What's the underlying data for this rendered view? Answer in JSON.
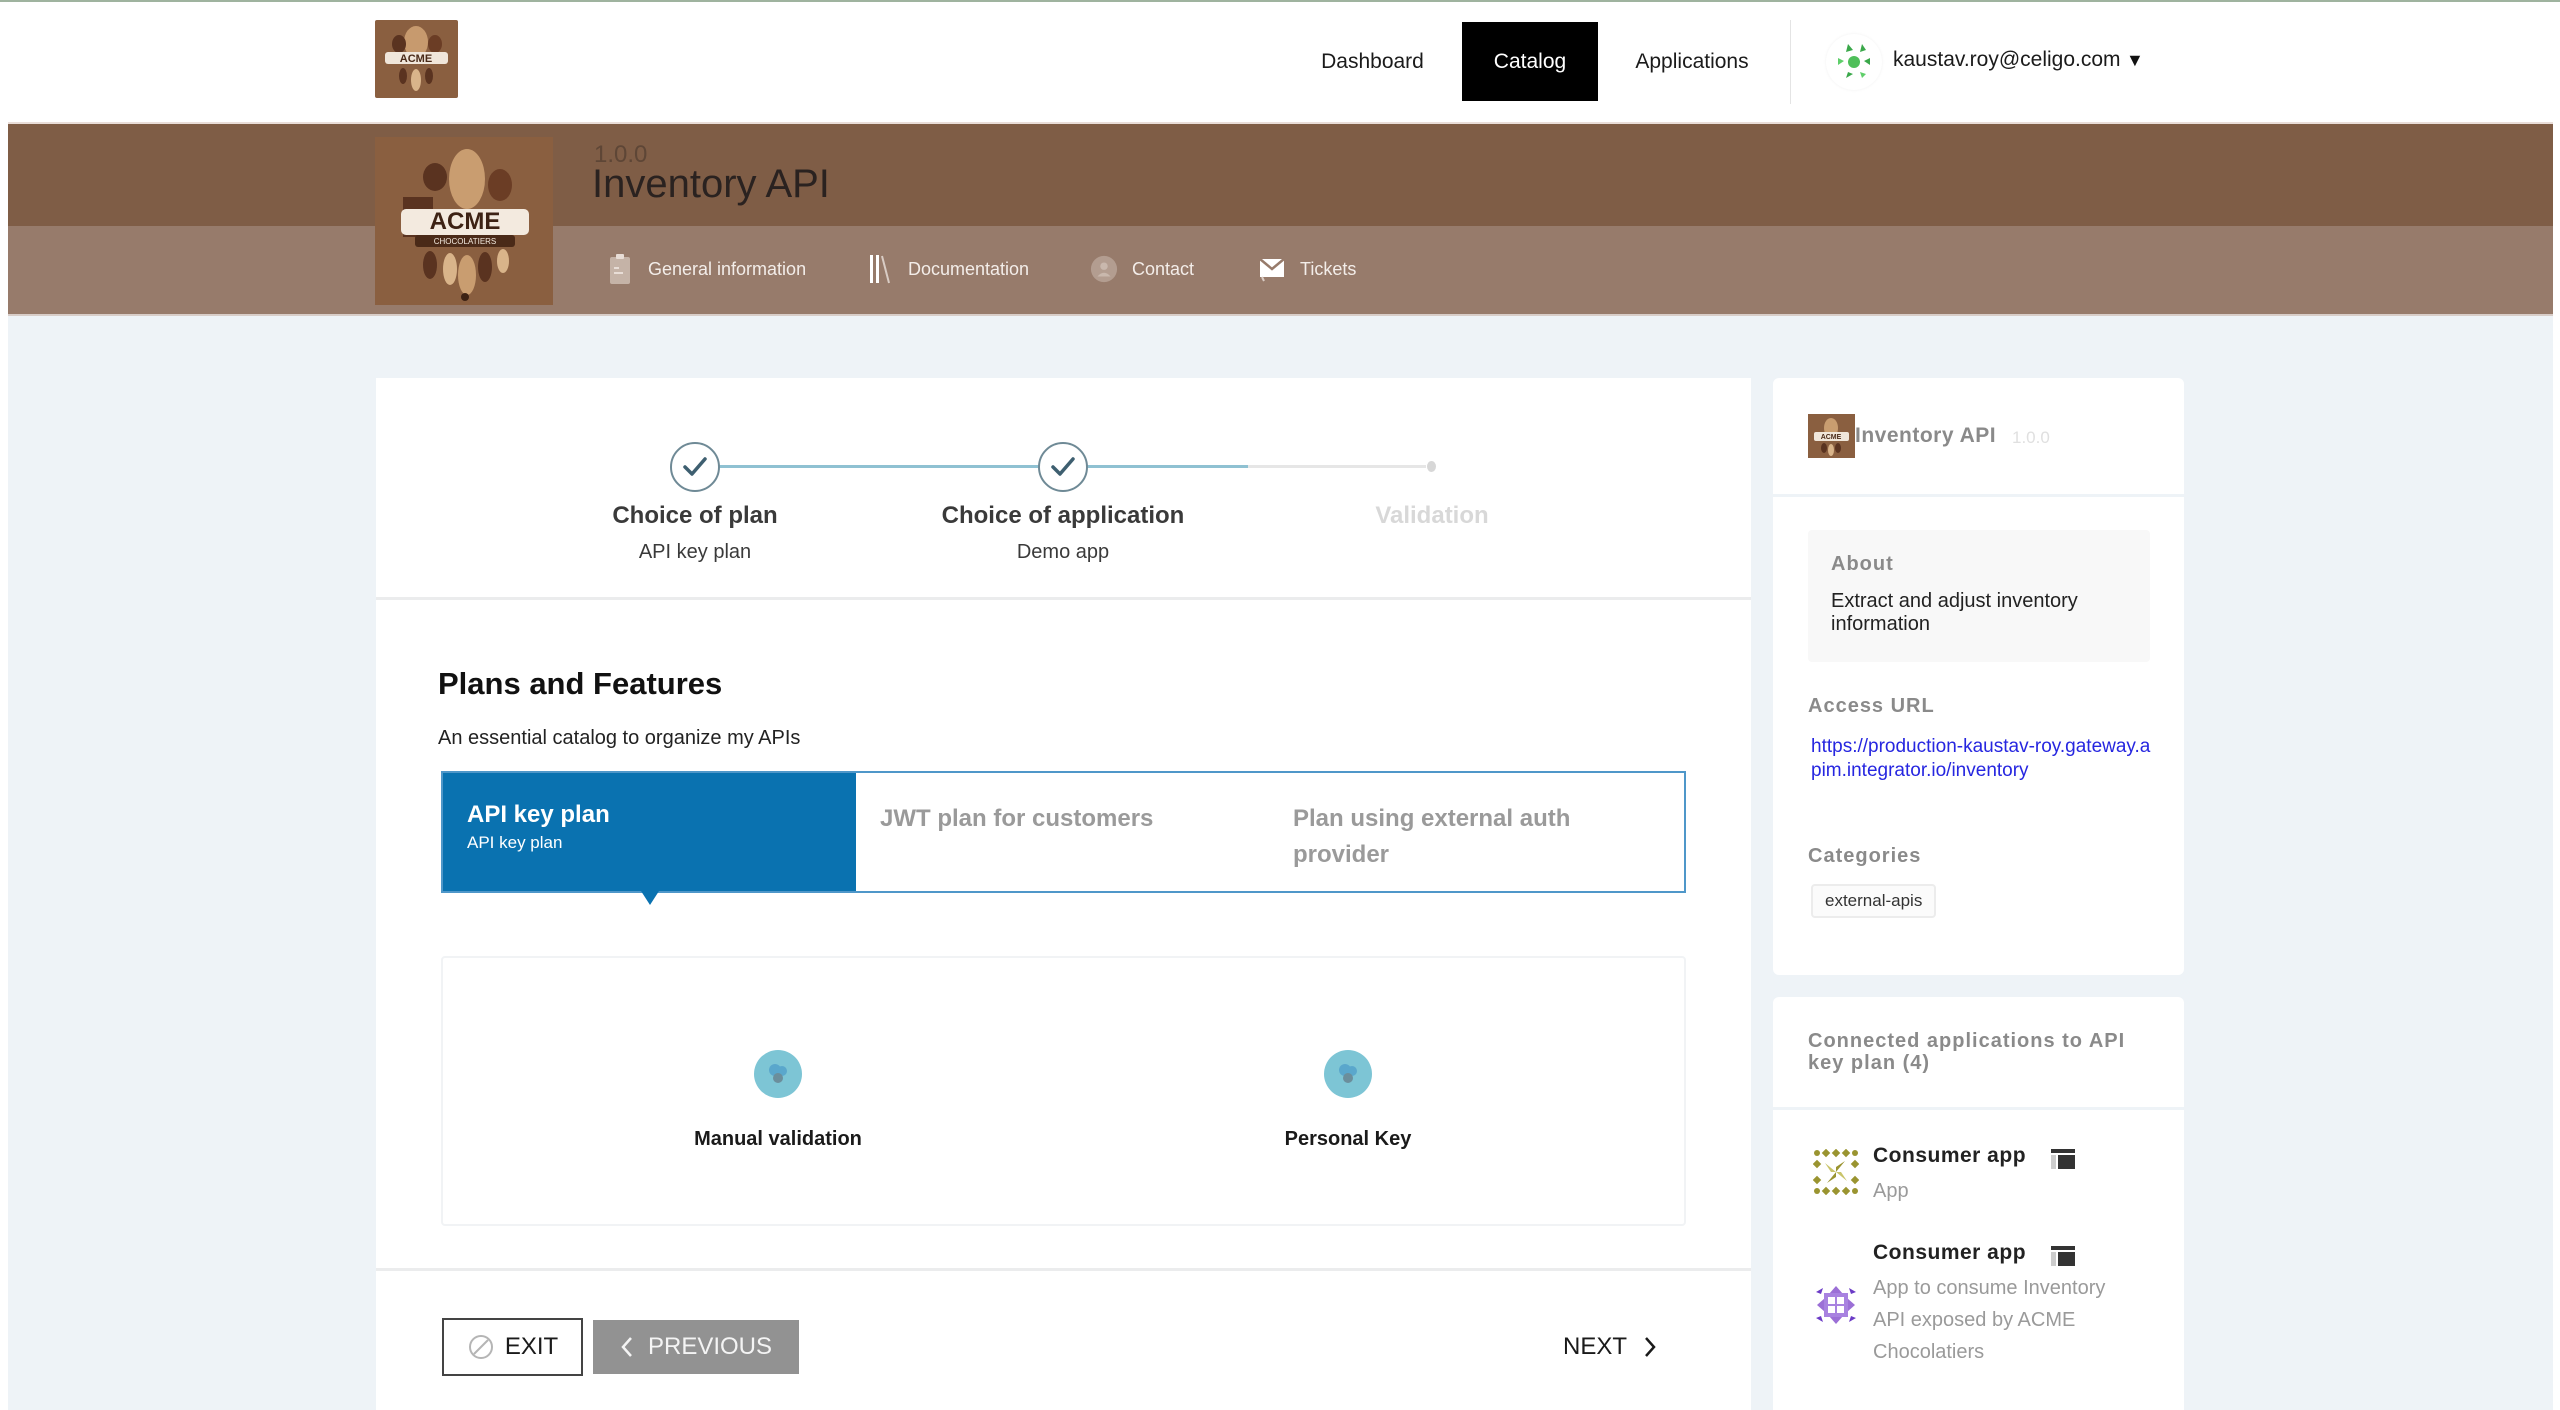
{
  "header": {
    "logo_alt": "ACME Chocolatiers logo",
    "nav": [
      {
        "label": "Dashboard",
        "active": false
      },
      {
        "label": "Catalog",
        "active": true
      },
      {
        "label": "Applications",
        "active": false
      }
    ],
    "user": {
      "email": "kaustav.roy@celigo.com",
      "caret": "▼"
    }
  },
  "banner": {
    "version": "1.0.0",
    "title": "Inventory API",
    "subnav": [
      {
        "label": "General information",
        "icon": "clipboard-icon"
      },
      {
        "label": "Documentation",
        "icon": "books-icon"
      },
      {
        "label": "Contact",
        "icon": "user-icon"
      },
      {
        "label": "Tickets",
        "icon": "ticket-icon"
      }
    ]
  },
  "stepper": {
    "steps": [
      {
        "label": "Choice of plan",
        "sub": "API key plan",
        "status": "completed"
      },
      {
        "label": "Choice of application",
        "sub": "Demo app",
        "status": "completed"
      },
      {
        "label": "Validation",
        "sub": "",
        "status": "pending"
      }
    ]
  },
  "plans": {
    "title": "Plans and Features",
    "description": "An essential catalog to organize my APIs",
    "tabs": [
      {
        "name": "API key plan",
        "sub": "API key plan",
        "active": true
      },
      {
        "name": "JWT plan for customers",
        "sub": "",
        "active": false
      },
      {
        "name": "Plan using external auth provider",
        "sub": "",
        "active": false
      }
    ],
    "features": [
      {
        "label": "Manual validation"
      },
      {
        "label": "Personal Key"
      }
    ]
  },
  "footer": {
    "exit_label": "EXIT",
    "previous_label": "PREVIOUS",
    "next_label": "NEXT"
  },
  "sidebar": {
    "api_name": "Inventory API",
    "api_version": "1.0.0",
    "about_label": "About",
    "about_text": "Extract and adjust inventory information",
    "access_url_label": "Access URL",
    "access_url": "https://production-kaustav-roy.gateway.apim.integrator.io/inventory",
    "categories_label": "Categories",
    "categories": [
      "external-apis"
    ],
    "connected_title": "Connected applications to API key plan (4)",
    "connected_apps": [
      {
        "name": "Consumer app",
        "description": "App"
      },
      {
        "name": "Consumer app",
        "description": "App to consume Inventory API exposed by ACME Chocolatiers"
      }
    ]
  },
  "colors": {
    "banner_dark": "#7f5d46",
    "banner_light": "#977b6b",
    "page_bg": "#eef3f7",
    "accent_blue": "#0a72b0",
    "step_line": "#8fc1d2",
    "link_blue": "#2626e0",
    "nav_active_bg": "#000000"
  }
}
